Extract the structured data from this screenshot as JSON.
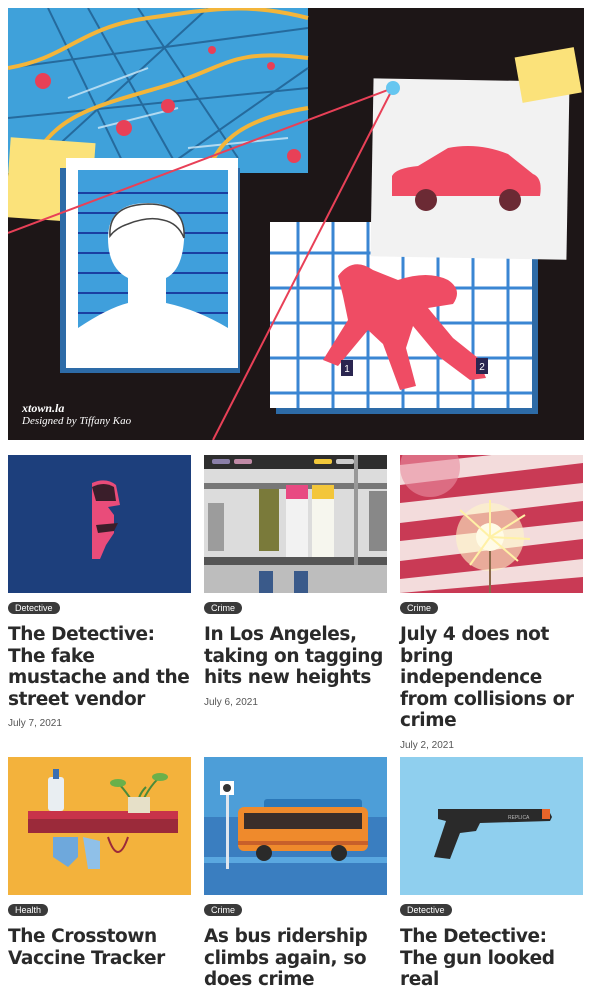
{
  "hero": {
    "brand": "xtown.la",
    "credit": "Designed by Tiffany Kao",
    "marker_1": "1",
    "marker_2": "2"
  },
  "articles": [
    {
      "tag": "Detective",
      "title": "The Detective: The fake mustache and the street vendor",
      "date": "July 7, 2021"
    },
    {
      "tag": "Crime",
      "title": "In Los Angeles, taking on tagging hits new heights",
      "date": "July 6, 2021"
    },
    {
      "tag": "Crime",
      "title": "July 4 does not bring independence from collisions or crime",
      "date": "July 2, 2021"
    },
    {
      "tag": "Health",
      "title": "The Crosstown Vaccine Tracker",
      "date": ""
    },
    {
      "tag": "Crime",
      "title": "As bus ridership climbs again, so does crime",
      "date": ""
    },
    {
      "tag": "Detective",
      "title": "The Detective: The gun looked real",
      "date": ""
    }
  ],
  "gun_label": "REPLICA",
  "colors": {
    "tag_bg": "#3a3a3a",
    "hero_bg": "#1d1617",
    "accent_red": "#ef4c64",
    "map_blue": "#41a1d8"
  }
}
